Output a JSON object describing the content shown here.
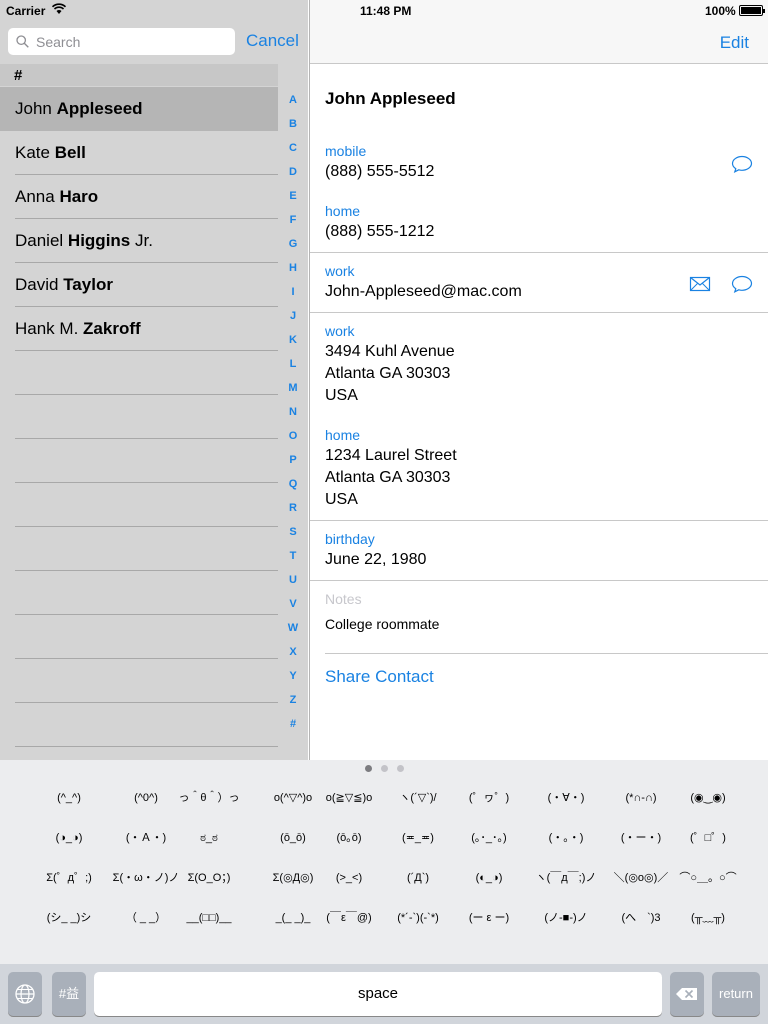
{
  "status_bar": {
    "carrier": "Carrier",
    "time": "11:48 PM",
    "battery": "100%"
  },
  "search": {
    "placeholder": "Search",
    "cancel_label": "Cancel"
  },
  "list": {
    "section": "#",
    "contacts": [
      {
        "first": "John ",
        "last": "Appleseed"
      },
      {
        "first": "Kate ",
        "last": "Bell"
      },
      {
        "first": "Anna ",
        "last": "Haro"
      },
      {
        "first": "Daniel ",
        "last": "Higgins",
        "suffix": " Jr."
      },
      {
        "first": "David ",
        "last": "Taylor"
      },
      {
        "first": "Hank M. ",
        "last": "Zakroff"
      }
    ],
    "index": [
      "A",
      "B",
      "C",
      "D",
      "E",
      "F",
      "G",
      "H",
      "I",
      "J",
      "K",
      "L",
      "M",
      "N",
      "O",
      "P",
      "Q",
      "R",
      "S",
      "T",
      "U",
      "V",
      "W",
      "X",
      "Y",
      "Z",
      "#"
    ]
  },
  "detail": {
    "edit_label": "Edit",
    "name": "John Appleseed",
    "mobile_label": "mobile",
    "mobile_value": "(888) 555-5512",
    "home_phone_label": "home",
    "home_phone_value": "(888) 555-1212",
    "work_email_label": "work",
    "work_email_value": "John-Appleseed@mac.com",
    "work_address_label": "work",
    "work_address_lines": [
      "3494 Kuhl Avenue",
      "Atlanta GA 30303",
      "USA"
    ],
    "home_address_label": "home",
    "home_address_lines": [
      "1234 Laurel Street",
      "Atlanta GA 30303",
      "USA"
    ],
    "birthday_label": "birthday",
    "birthday_value": "June 22, 1980",
    "notes_label": "Notes",
    "notes_value": "College roommate",
    "share_label": "Share Contact"
  },
  "keyboard": {
    "emoticons": [
      [
        "(^_^)",
        "(^0^)",
        "っ＾θ＾）っ",
        "o(^▽^)o",
        "o(≧▽≦)o",
        "ヽ(´▽`)/",
        "(゜ヮ゜)",
        "(・∀・)",
        "(*∩-∩)",
        "(◉‿◉)"
      ],
      [
        "(◑_◑)",
        "(・Ａ・)",
        "ಠ_ಠ",
        "(ō_ō)",
        "(ō｡ō)",
        "(≖_≖)",
        "(｡･_･｡)",
        "(・。・)",
        "(・ー・)",
        "(゜□゜)"
      ],
      [
        "Σ(゜д゜;)",
        "Σ(・ω・ノ)ノ",
        "Σ(O_O；)",
        "Σ(◎Д◎)",
        "(>_<)",
        "(´Д`)",
        "(◐_◑)",
        "ヽ(￣д￣;)ノ",
        "＼(◎o◎)／",
        "⌒○＿。○⌒"
      ],
      [
        "(シ_ _)シ",
        "（ _ _）",
        "__(□□)__",
        "_(_ _)_",
        "(￣ε￣@)",
        "(*´-`)(-`*)",
        "(ー ε ー)",
        "(ノ-■-)ノ",
        "(へ　`)3",
        "(╥﹏╥)"
      ]
    ],
    "cjk_label": "#‌益",
    "space_label": "space",
    "return_label": "return"
  }
}
